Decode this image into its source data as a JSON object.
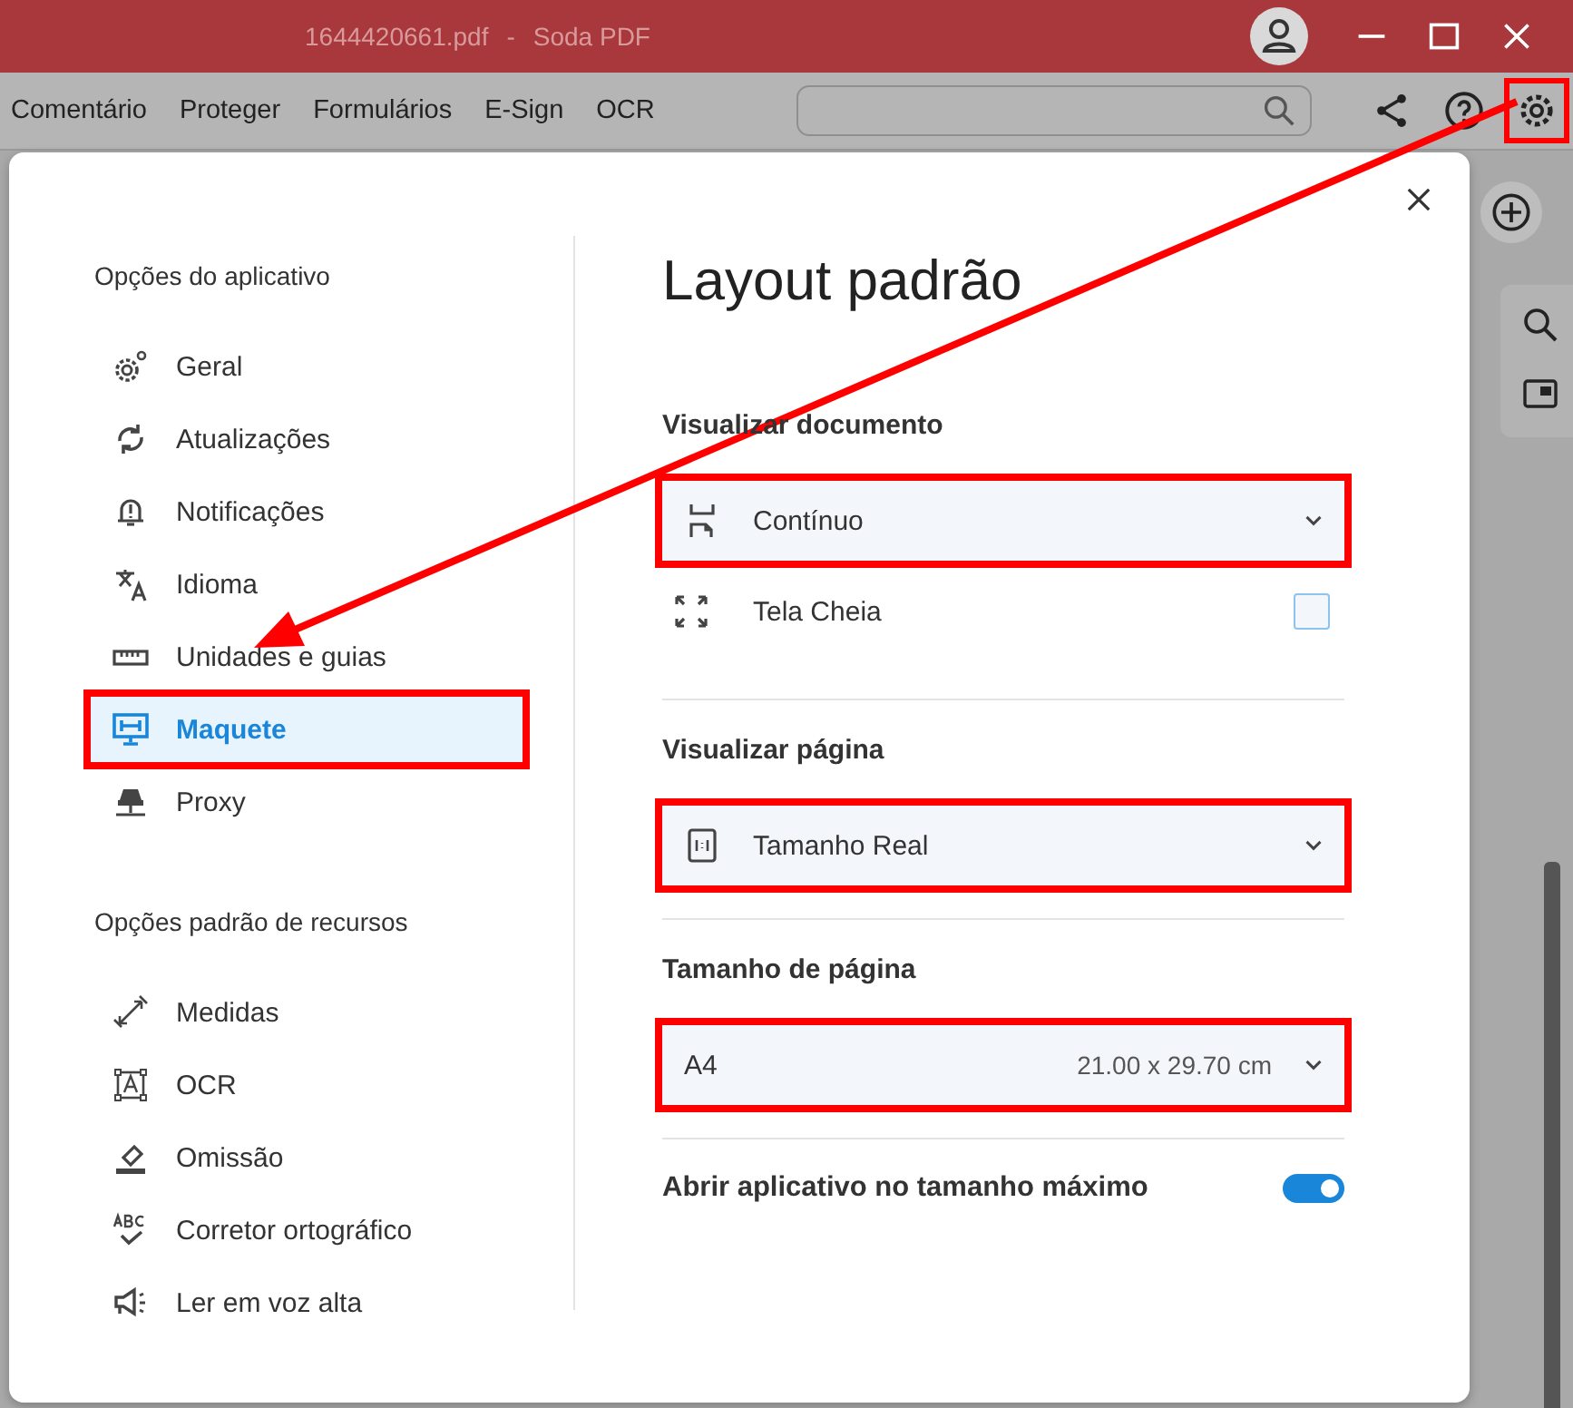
{
  "window": {
    "file": "1644420661.pdf",
    "separator": "-",
    "app": "Soda PDF"
  },
  "menu": [
    {
      "label": "Comentário"
    },
    {
      "label": "Proteger"
    },
    {
      "label": "Formulários"
    },
    {
      "label": "E-Sign"
    },
    {
      "label": "OCR"
    }
  ],
  "toolbar": [
    {
      "highlighted": false
    },
    {
      "highlighted": false
    },
    {
      "highlighted": true
    }
  ],
  "sidebar": [
    {
      "heading": "Opções do aplicativo",
      "items": [
        {
          "label": "Geral",
          "selected": false,
          "highlighted": false
        },
        {
          "label": "Atualizações",
          "selected": false,
          "highlighted": false
        },
        {
          "label": "Notificações",
          "selected": false,
          "highlighted": false
        },
        {
          "label": "Idioma",
          "selected": false,
          "highlighted": false
        },
        {
          "label": "Unidades e guias",
          "selected": false,
          "highlighted": false
        },
        {
          "label": "Maquete",
          "selected": true,
          "highlighted": true
        },
        {
          "label": "Proxy",
          "selected": false,
          "highlighted": false
        }
      ]
    },
    {
      "heading": "Opções padrão de recursos",
      "items": [
        {
          "label": "Medidas",
          "selected": false,
          "highlighted": false
        },
        {
          "label": "OCR",
          "selected": false,
          "highlighted": false
        },
        {
          "label": "Omissão",
          "selected": false,
          "highlighted": false
        },
        {
          "label": "Corretor ortográfico",
          "selected": false,
          "highlighted": false
        },
        {
          "label": "Ler em voz alta",
          "selected": false,
          "highlighted": false
        }
      ]
    }
  ],
  "content": {
    "title": "Layout padrão",
    "rows": [
      {
        "kind": "heading",
        "label": "Visualizar documento"
      },
      {
        "kind": "dropdown",
        "value": "Contínuo",
        "highlighted": true
      },
      {
        "kind": "checkbox",
        "label": "Tela Cheia",
        "checked": false
      },
      {
        "kind": "divider"
      },
      {
        "kind": "heading",
        "label": "Visualizar página"
      },
      {
        "kind": "dropdown",
        "value": "Tamanho Real",
        "highlighted": true
      },
      {
        "kind": "divider"
      },
      {
        "kind": "heading",
        "label": "Tamanho de página"
      },
      {
        "kind": "dropdown",
        "value": "A4",
        "detail": "21.00 x 29.70 cm",
        "highlighted": true
      },
      {
        "kind": "divider"
      },
      {
        "kind": "toggle",
        "label": "Abrir aplicativo no tamanho máximo",
        "on": true
      }
    ]
  }
}
